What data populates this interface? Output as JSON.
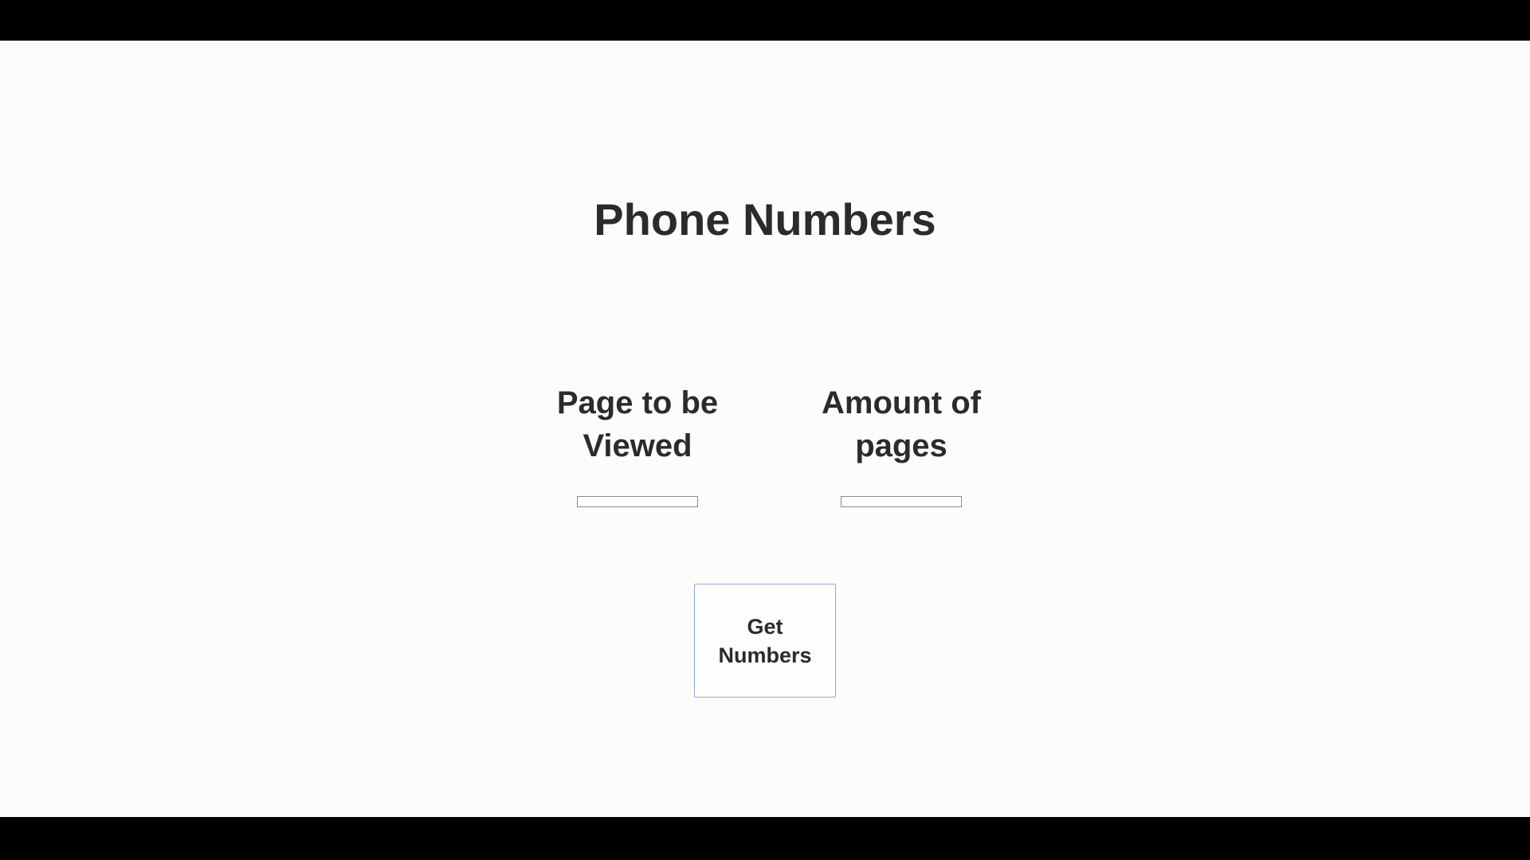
{
  "page": {
    "title": "Phone Numbers"
  },
  "fields": {
    "page_to_view": {
      "label": "Page to be Viewed",
      "value": ""
    },
    "amount_of_pages": {
      "label": "Amount of pages",
      "value": ""
    }
  },
  "actions": {
    "get_numbers_label": "Get Numbers"
  },
  "colors": {
    "background": "#fcfcfa",
    "text": "#2b2b2b",
    "letterbox": "#000000",
    "button_border": "#8fa8d8"
  }
}
